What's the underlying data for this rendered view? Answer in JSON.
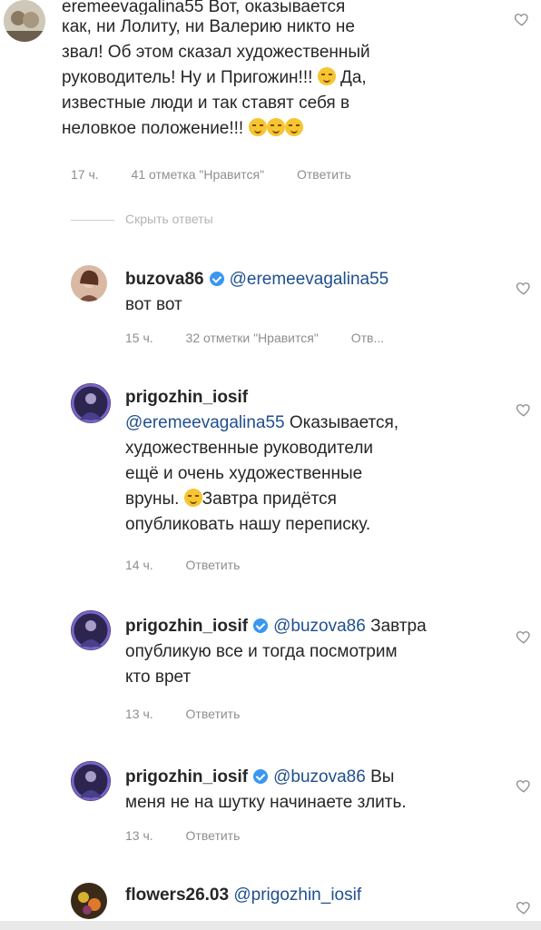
{
  "comments": [
    {
      "username": "eremeevagalina55",
      "lines": [
        "eremeevagalina55 Вот, оказывается",
        "как, ни Лолиту, ни Валерию никто не",
        "звал! Об этом сказал художественный",
        "руководитель! Ну и Пригожин!!!",
        "Да,",
        "известные люди и так ставят себя в",
        "неловкое положение!!!"
      ],
      "time": "17 ч.",
      "likes": "41 отметка \"Нравится\"",
      "reply": "Ответить"
    },
    {
      "username": "buzova86",
      "mention": "@eremeevagalina55",
      "text": "вот вот",
      "time": "15 ч.",
      "likes": "32 отметки \"Нравится\"",
      "reply": "Отв..."
    },
    {
      "username": "prigozhin_iosif",
      "mention": "@eremeevagalina55",
      "line1": "Оказывается,",
      "line2": "художественные руководители",
      "line3": "ещё и очень художественные",
      "line4a": "вруны.",
      "line4b": "Завтра придётся",
      "line5": "опубликовать нашу переписку.",
      "time": "14 ч.",
      "reply": "Ответить"
    },
    {
      "username": "prigozhin_iosif",
      "mention": "@buzova86",
      "line1": "Завтра",
      "line2": "опубликую все и тогда посмотрим",
      "line3": "кто врет",
      "time": "13 ч.",
      "reply": "Ответить"
    },
    {
      "username": "prigozhin_iosif",
      "mention": "@buzova86",
      "line1": "Вы",
      "line2": "меня не на шутку начинаете злить.",
      "time": "13 ч.",
      "reply": "Ответить"
    },
    {
      "username": "flowers26.03",
      "mention": "@prigozhin_iosif"
    }
  ],
  "hide_replies": "Скрыть ответы",
  "icons": {
    "heart": "heart-outline-icon",
    "verified": "verified-badge-icon",
    "emoji": "emoji-icon"
  },
  "colors": {
    "verified": "#3897f0",
    "meta": "#8e8e8e",
    "mention": "#1f4f8f"
  }
}
